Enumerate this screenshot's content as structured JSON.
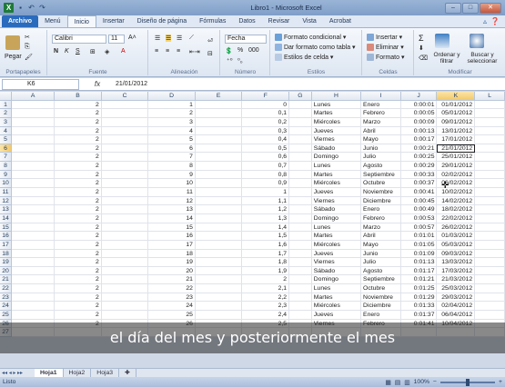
{
  "window": {
    "title": "Libro1 - Microsoft Excel",
    "excel_logo": "X",
    "qat_undo": "↶",
    "qat_redo": "↷",
    "qat_save": "▪",
    "minimize": "–",
    "maximize": "□",
    "close": "✕"
  },
  "ribbon_tabs": [
    "Archivo",
    "Menú",
    "Inicio",
    "Insertar",
    "Diseño de página",
    "Fórmulas",
    "Datos",
    "Revisar",
    "Vista",
    "Acrobat"
  ],
  "ribbon": {
    "clipboard": {
      "paste": "Pegar",
      "label": "Portapapeles"
    },
    "font": {
      "name": "Calibri",
      "size": "11",
      "label": "Fuente",
      "bold": "N",
      "italic": "K",
      "underline": "S"
    },
    "alignment": {
      "label": "Alineación"
    },
    "number": {
      "format": "Fecha",
      "percent": "%",
      "thousands": "000",
      "label": "Número"
    },
    "styles": {
      "conditional": "Formato condicional",
      "as_table": "Dar formato como tabla",
      "cell_styles": "Estilos de celda",
      "label": "Estilos"
    },
    "cells": {
      "insert": "Insertar",
      "delete": "Eliminar",
      "format": "Formato",
      "label": "Celdas"
    },
    "editing": {
      "sum": "Σ",
      "sort": "Ordenar y filtrar",
      "find": "Buscar y seleccionar",
      "label": "Modificar"
    }
  },
  "formula_bar": {
    "name_box": "K6",
    "fx": "fx",
    "value": "21/01/2012"
  },
  "columns": [
    "A",
    "B",
    "C",
    "D",
    "E",
    "F",
    "G",
    "H",
    "I",
    "J",
    "K",
    "L"
  ],
  "rows": [
    {
      "n": "1",
      "B": "2",
      "D": "1",
      "F": "0",
      "H": "Lunes",
      "I": "Enero",
      "J": "0:00:01",
      "K": "01/01/2012"
    },
    {
      "n": "2",
      "B": "2",
      "D": "2",
      "F": "0,1",
      "H": "Martes",
      "I": "Febrero",
      "J": "0:00:05",
      "K": "05/01/2012"
    },
    {
      "n": "3",
      "B": "2",
      "D": "3",
      "F": "0,2",
      "H": "Miércoles",
      "I": "Marzo",
      "J": "0:00:09",
      "K": "09/01/2012"
    },
    {
      "n": "4",
      "B": "2",
      "D": "4",
      "F": "0,3",
      "H": "Jueves",
      "I": "Abril",
      "J": "0:00:13",
      "K": "13/01/2012"
    },
    {
      "n": "5",
      "B": "2",
      "D": "5",
      "F": "0,4",
      "H": "Viernes",
      "I": "Mayo",
      "J": "0:00:17",
      "K": "17/01/2012"
    },
    {
      "n": "6",
      "B": "2",
      "D": "6",
      "F": "0,5",
      "H": "Sábado",
      "I": "Junio",
      "J": "0:00:21",
      "K": "21/01/2012"
    },
    {
      "n": "7",
      "B": "2",
      "D": "7",
      "F": "0,6",
      "H": "Domingo",
      "I": "Julio",
      "J": "0:00:25",
      "K": "25/01/2012"
    },
    {
      "n": "8",
      "B": "2",
      "D": "8",
      "F": "0,7",
      "H": "Lunes",
      "I": "Agosto",
      "J": "0:00:29",
      "K": "29/01/2012"
    },
    {
      "n": "9",
      "B": "2",
      "D": "9",
      "F": "0,8",
      "H": "Martes",
      "I": "Septiembre",
      "J": "0:00:33",
      "K": "02/02/2012"
    },
    {
      "n": "10",
      "B": "2",
      "D": "10",
      "F": "0,9",
      "H": "Miércoles",
      "I": "Octubre",
      "J": "0:00:37",
      "K": "06/02/2012"
    },
    {
      "n": "11",
      "B": "2",
      "D": "11",
      "F": "1",
      "H": "Jueves",
      "I": "Noviembre",
      "J": "0:00:41",
      "K": "10/02/2012"
    },
    {
      "n": "12",
      "B": "2",
      "D": "12",
      "F": "1,1",
      "H": "Viernes",
      "I": "Diciembre",
      "J": "0:00:45",
      "K": "14/02/2012"
    },
    {
      "n": "13",
      "B": "2",
      "D": "13",
      "F": "1,2",
      "H": "Sábado",
      "I": "Enero",
      "J": "0:00:49",
      "K": "18/02/2012"
    },
    {
      "n": "14",
      "B": "2",
      "D": "14",
      "F": "1,3",
      "H": "Domingo",
      "I": "Febrero",
      "J": "0:00:53",
      "K": "22/02/2012"
    },
    {
      "n": "15",
      "B": "2",
      "D": "15",
      "F": "1,4",
      "H": "Lunes",
      "I": "Marzo",
      "J": "0:00:57",
      "K": "26/02/2012"
    },
    {
      "n": "16",
      "B": "2",
      "D": "16",
      "F": "1,5",
      "H": "Martes",
      "I": "Abril",
      "J": "0:01:01",
      "K": "01/03/2012"
    },
    {
      "n": "17",
      "B": "2",
      "D": "17",
      "F": "1,6",
      "H": "Miércoles",
      "I": "Mayo",
      "J": "0:01:05",
      "K": "05/03/2012"
    },
    {
      "n": "18",
      "B": "2",
      "D": "18",
      "F": "1,7",
      "H": "Jueves",
      "I": "Junio",
      "J": "0:01:09",
      "K": "09/03/2012"
    },
    {
      "n": "19",
      "B": "2",
      "D": "19",
      "F": "1,8",
      "H": "Viernes",
      "I": "Julio",
      "J": "0:01:13",
      "K": "13/03/2012"
    },
    {
      "n": "20",
      "B": "2",
      "D": "20",
      "F": "1,9",
      "H": "Sábado",
      "I": "Agosto",
      "J": "0:01:17",
      "K": "17/03/2012"
    },
    {
      "n": "21",
      "B": "2",
      "D": "21",
      "F": "2",
      "H": "Domingo",
      "I": "Septiembre",
      "J": "0:01:21",
      "K": "21/03/2012"
    },
    {
      "n": "22",
      "B": "2",
      "D": "22",
      "F": "2,1",
      "H": "Lunes",
      "I": "Octubre",
      "J": "0:01:25",
      "K": "25/03/2012"
    },
    {
      "n": "23",
      "B": "2",
      "D": "23",
      "F": "2,2",
      "H": "Martes",
      "I": "Noviembre",
      "J": "0:01:29",
      "K": "29/03/2012"
    },
    {
      "n": "24",
      "B": "2",
      "D": "24",
      "F": "2,3",
      "H": "Miércoles",
      "I": "Diciembre",
      "J": "0:01:33",
      "K": "02/04/2012"
    },
    {
      "n": "25",
      "B": "2",
      "D": "25",
      "F": "2,4",
      "H": "Jueves",
      "I": "Enero",
      "J": "0:01:37",
      "K": "06/04/2012"
    },
    {
      "n": "26",
      "B": "2",
      "D": "26",
      "F": "2,5",
      "H": "Viernes",
      "I": "Febrero",
      "J": "0:01:41",
      "K": "10/04/2012"
    },
    {
      "n": "27",
      "B": "",
      "D": "",
      "F": "",
      "H": "",
      "I": "",
      "J": "",
      "K": ""
    }
  ],
  "active_row": "6",
  "sheets": [
    "Hoja1",
    "Hoja2",
    "Hoja3"
  ],
  "status": {
    "ready": "Listo",
    "zoom": "100%",
    "zoom_minus": "−",
    "zoom_plus": "+"
  },
  "subtitle": "el día del mes y posteriormente el mes",
  "colors": {
    "file_tab": "#2b6bbd",
    "selection_header": "#f3c96b",
    "excel_green": "#1f7a3a"
  }
}
